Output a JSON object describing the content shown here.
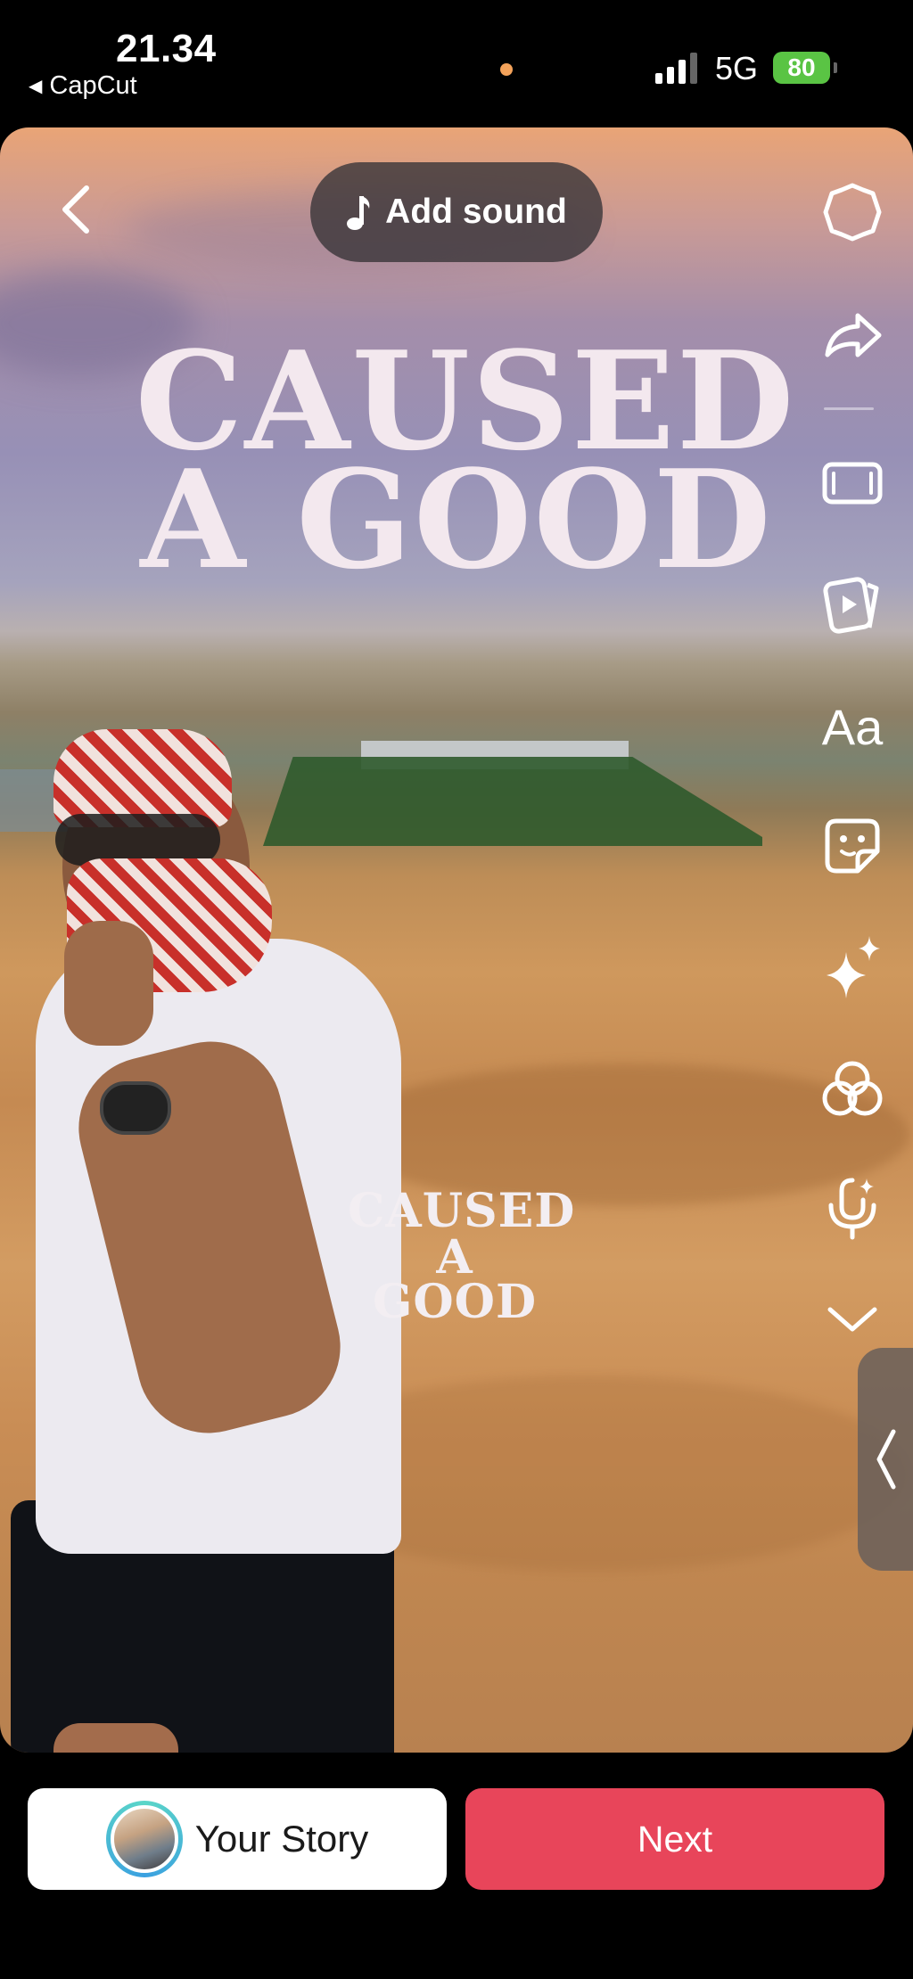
{
  "status_bar": {
    "time": "21.34",
    "back_app": "CapCut",
    "network": "5G",
    "battery": "80"
  },
  "preview": {
    "title_line1": "CAUSED",
    "title_line2": "A GOOD",
    "small_title_line1": "CAUSED",
    "small_title_line2": "A GOOD",
    "add_sound_label": "Add sound"
  },
  "tools": {
    "text_label": "Aa",
    "icons": [
      "settings-icon",
      "share-icon",
      "aspect-ratio-icon",
      "templates-icon",
      "text-icon",
      "sticker-icon",
      "effects-icon",
      "filters-icon",
      "voice-effects-icon",
      "expand-more-icon"
    ]
  },
  "bottom": {
    "your_story_label": "Your Story",
    "next_label": "Next",
    "next_color": "#e8455a"
  }
}
